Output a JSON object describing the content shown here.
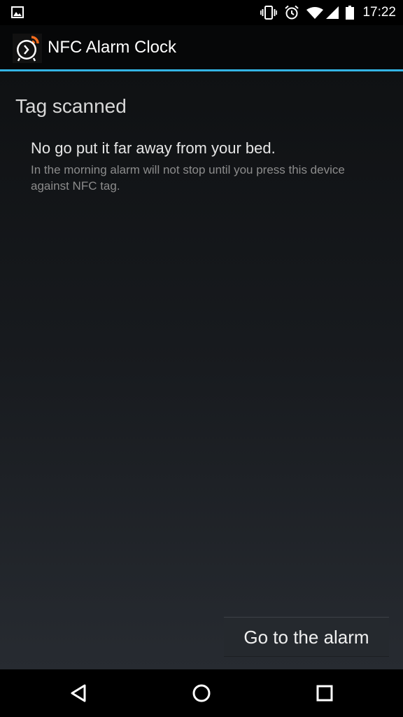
{
  "status_bar": {
    "time": "17:22",
    "icons": [
      "image-icon",
      "vibrate-icon",
      "alarm-clock-icon",
      "wifi-icon",
      "signal-icon",
      "battery-icon"
    ]
  },
  "action_bar": {
    "title": "NFC Alarm Clock",
    "icon": "nfc-alarm-clock-app-icon",
    "accent_color": "#33b5e5",
    "logo_color": "#f26b1d"
  },
  "main": {
    "section_title": "Tag scanned",
    "message_title": "No go put it far away from your bed.",
    "message_body": "In the morning alarm will not stop until you press this device against NFC tag.",
    "button_label": "Go to the alarm"
  },
  "nav_bar": {
    "buttons": [
      "back-icon",
      "home-icon",
      "recents-icon"
    ]
  }
}
